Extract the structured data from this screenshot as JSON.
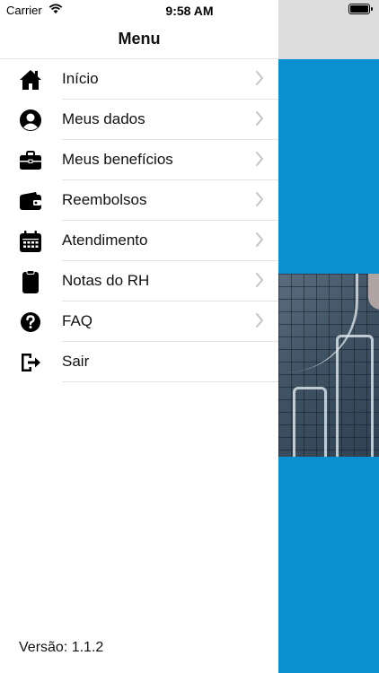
{
  "status_bar": {
    "carrier": "Carrier",
    "time": "9:58 AM"
  },
  "menu": {
    "title": "Menu",
    "items": [
      {
        "label": "Início",
        "icon": "home-icon"
      },
      {
        "label": "Meus dados",
        "icon": "user-circle-icon"
      },
      {
        "label": "Meus benefícios",
        "icon": "briefcase-icon"
      },
      {
        "label": "Reembolsos",
        "icon": "wallet-icon"
      },
      {
        "label": "Atendimento",
        "icon": "calendar-icon"
      },
      {
        "label": "Notas do RH",
        "icon": "clipboard-icon"
      },
      {
        "label": "FAQ",
        "icon": "question-circle-icon"
      },
      {
        "label": "Sair",
        "icon": "sign-out-icon"
      }
    ]
  },
  "footer": {
    "version": "Versão: 1.1.2"
  },
  "colors": {
    "accent_blue": "#0a8fd0",
    "drawer_bg": "#ffffff",
    "text": "#111111",
    "chevron": "#c4c4c7"
  }
}
